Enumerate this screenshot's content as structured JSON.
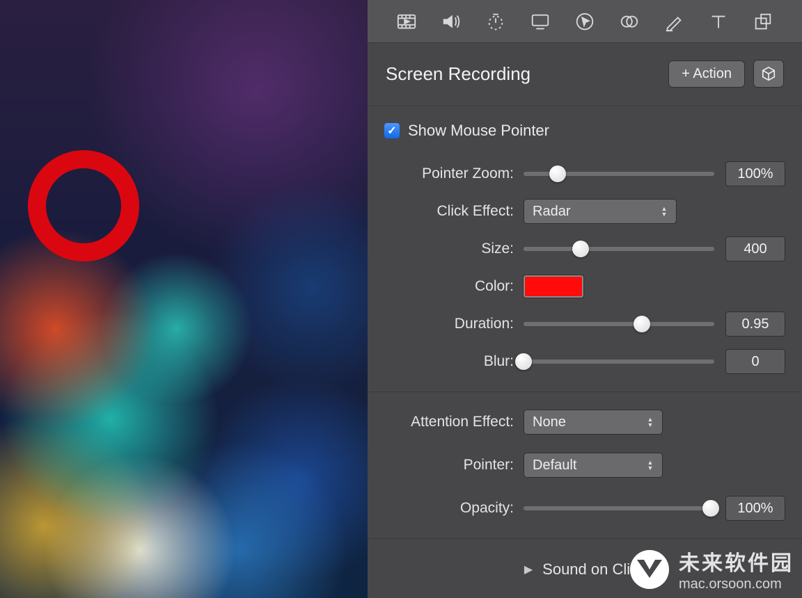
{
  "panel_title": "Screen Recording",
  "action_button": "+ Action",
  "checkbox": {
    "label": "Show Mouse Pointer",
    "checked": true
  },
  "controls": {
    "pointer_zoom": {
      "label": "Pointer Zoom:",
      "value": "100%",
      "thumb_pct": 18
    },
    "click_effect": {
      "label": "Click Effect:",
      "value": "Radar"
    },
    "size": {
      "label": "Size:",
      "value": "400",
      "thumb_pct": 30
    },
    "color": {
      "label": "Color:",
      "hex": "#ff0b0b"
    },
    "duration": {
      "label": "Duration:",
      "value": "0.95",
      "thumb_pct": 62
    },
    "blur": {
      "label": "Blur:",
      "value": "0",
      "thumb_pct": 0
    },
    "attention": {
      "label": "Attention Effect:",
      "value": "None"
    },
    "pointer": {
      "label": "Pointer:",
      "value": "Default"
    },
    "opacity": {
      "label": "Opacity:",
      "value": "100%",
      "thumb_pct": 98
    }
  },
  "disclosure": {
    "label": "Sound on Click"
  },
  "watermark": {
    "cn": "未来软件园",
    "url": "mac.orsoon.com"
  }
}
